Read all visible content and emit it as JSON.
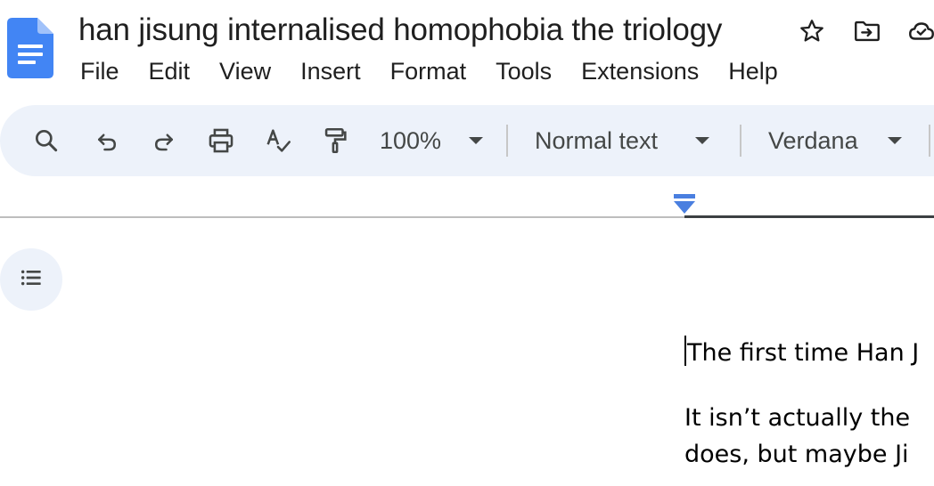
{
  "document": {
    "title": "han jisung internalised homophobia the triology"
  },
  "icons": {
    "logo": "google-docs-logo",
    "star": "star-icon",
    "move": "move-to-folder-icon",
    "cloud": "cloud-saved-icon"
  },
  "menu": {
    "items": [
      {
        "label": "File"
      },
      {
        "label": "Edit"
      },
      {
        "label": "View"
      },
      {
        "label": "Insert"
      },
      {
        "label": "Format"
      },
      {
        "label": "Tools"
      },
      {
        "label": "Extensions"
      },
      {
        "label": "Help"
      }
    ]
  },
  "toolbar": {
    "zoom": "100%",
    "paragraph_style": "Normal text",
    "font": "Verdana"
  },
  "body": {
    "paragraphs": [
      {
        "lines": [
          "The first time Han J"
        ]
      },
      {
        "lines": [
          "It isn’t actually the",
          "does, but maybe Ji"
        ]
      }
    ]
  },
  "colors": {
    "toolbar_bg": "#edf2fa",
    "docs_blue": "#4285f4",
    "indent_marker": "#4a7fe0",
    "text": "#1f1f1f",
    "icon": "#444746"
  }
}
